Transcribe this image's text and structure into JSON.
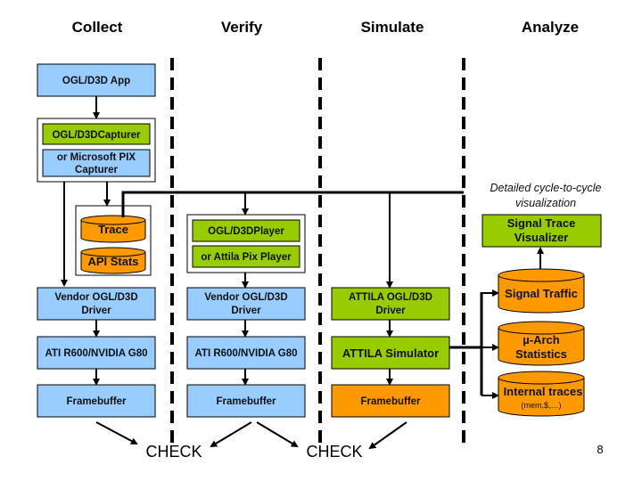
{
  "columns": {
    "collect": "Collect",
    "verify": "Verify",
    "simulate": "Simulate",
    "analyze": "Analyze"
  },
  "collect": {
    "app": "OGL/D3D App",
    "capturer": "OGL/D3DCapturer",
    "pix_capturer_line1": "or Microsoft PIX",
    "pix_capturer_line2": "Capturer",
    "trace": "Trace",
    "api_stats": "API Stats",
    "driver_line1": "Vendor OGL/D3D",
    "driver_line2": "Driver",
    "gpu": "ATI R600/NVIDIA G80",
    "framebuffer": "Framebuffer"
  },
  "verify": {
    "player": "OGL/D3DPlayer",
    "pix_player": "or Attila Pix Player",
    "driver_line1": "Vendor OGL/D3D",
    "driver_line2": "Driver",
    "gpu": "ATI R600/NVIDIA G80",
    "framebuffer": "Framebuffer"
  },
  "simulate": {
    "driver_line1": "ATTILA OGL/D3D",
    "driver_line2": "Driver",
    "simulator": "ATTILA Simulator",
    "framebuffer": "Framebuffer"
  },
  "analyze": {
    "note_line1": "Detailed cycle-to-cycle",
    "note_line2": "visualization",
    "visualizer_line1": "Signal Trace",
    "visualizer_line2": "Visualizer",
    "signal_traffic": "Signal Traffic",
    "arch_stats_line1": "µ-Arch",
    "arch_stats_line2": "Statistics",
    "internal_traces": "Internal traces",
    "internal_traces_sub": "(mem,$,…)"
  },
  "checks": [
    "CHECK",
    "CHECK"
  ],
  "page_number": "8",
  "colors": {
    "native_hw": "#99ccff",
    "attila_tool": "#99cc00",
    "data_output": "#ff9900"
  }
}
